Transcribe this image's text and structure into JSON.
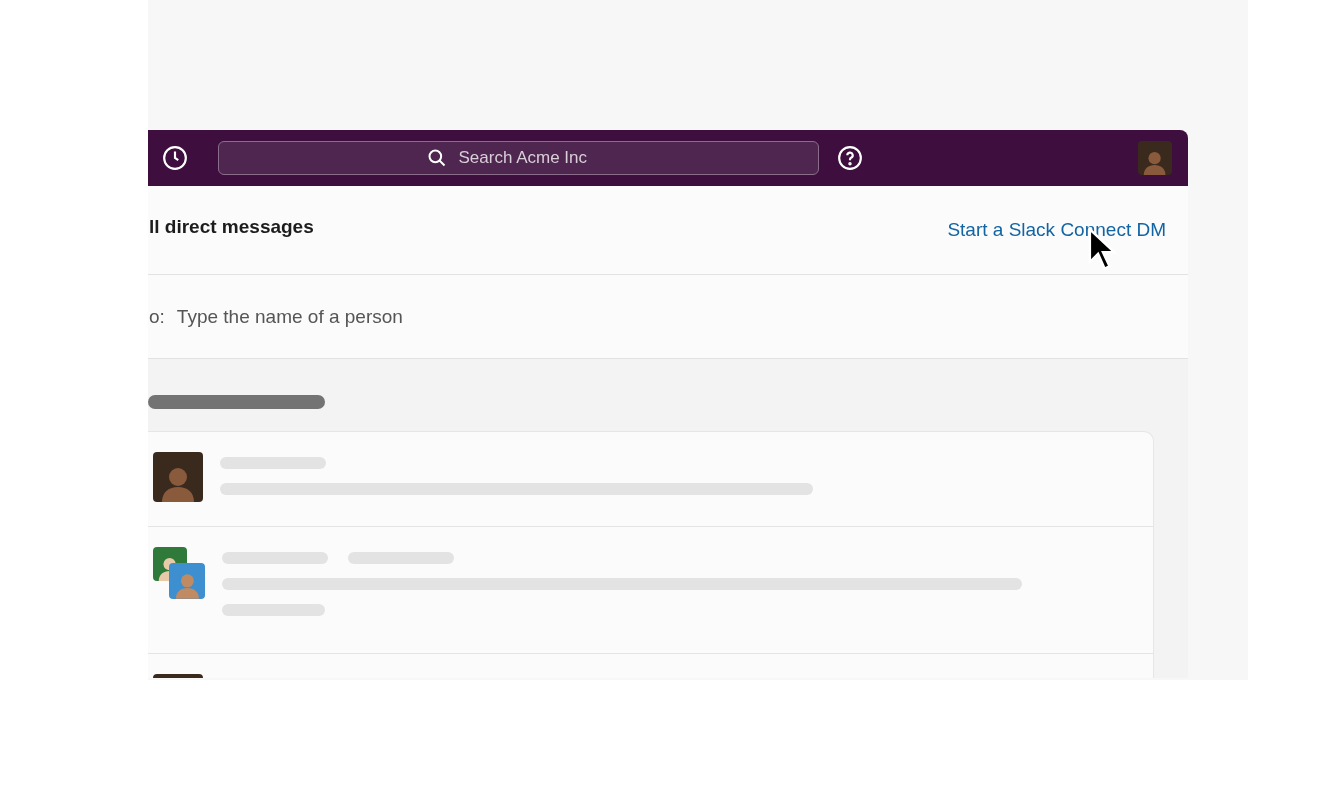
{
  "top_bar": {
    "search": {
      "placeholder": "Search Acme Inc"
    }
  },
  "header": {
    "title": "ll direct messages",
    "link": "Start a Slack Connect DM"
  },
  "to_field": {
    "label": "o:",
    "placeholder": "Type the name of a person"
  },
  "conversations": [
    {
      "kind": "single"
    },
    {
      "kind": "group"
    },
    {
      "kind": "single"
    }
  ]
}
